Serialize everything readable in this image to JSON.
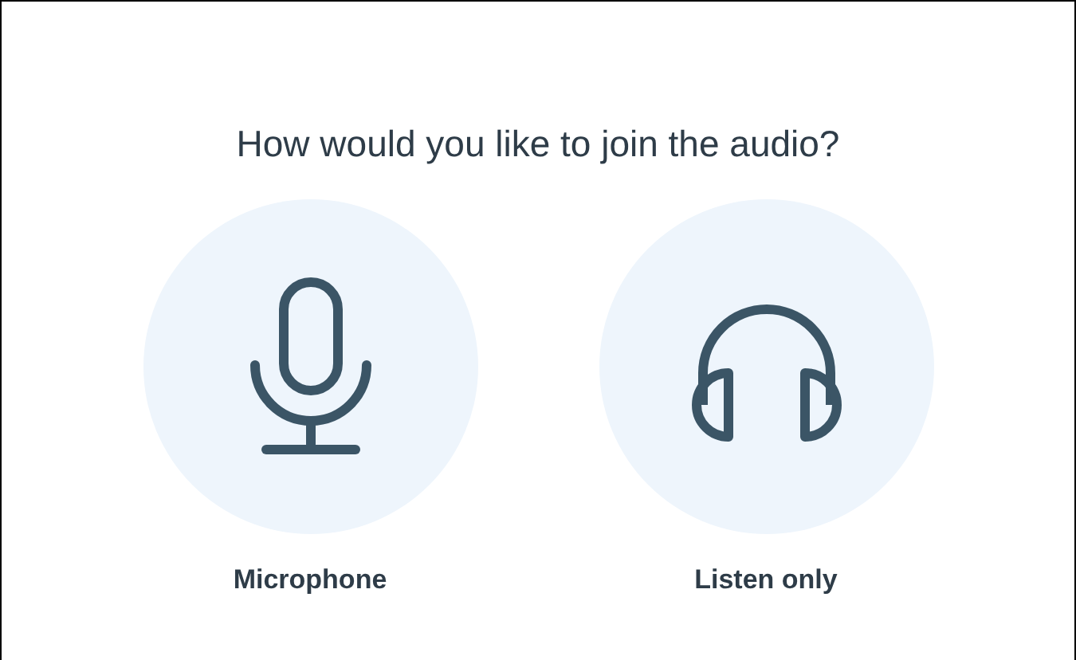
{
  "title": "How would you like to join the audio?",
  "options": [
    {
      "kind": "microphone",
      "label": "Microphone"
    },
    {
      "kind": "listen",
      "label": "Listen only"
    }
  ]
}
